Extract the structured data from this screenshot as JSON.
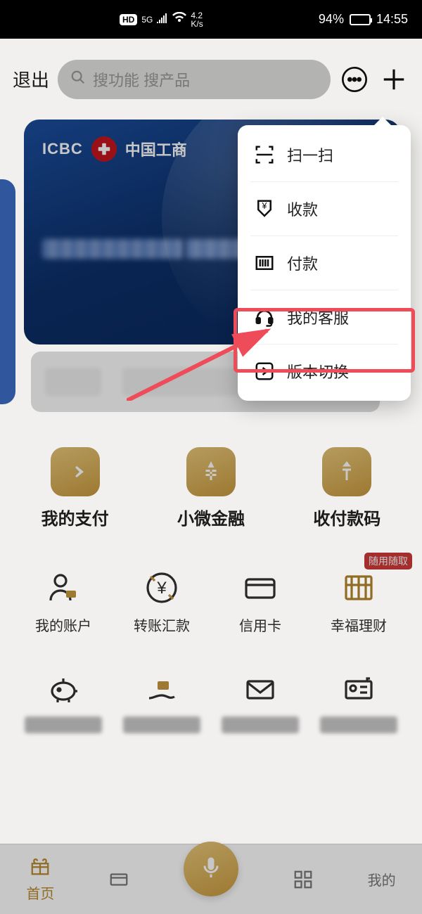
{
  "status": {
    "hd": "HD",
    "net": "5G",
    "speed_top": "4.2",
    "speed_bot": "K/s",
    "battery_pct": "94%",
    "time": "14:55"
  },
  "topbar": {
    "exit": "退出",
    "search_placeholder": "搜功能 搜产品"
  },
  "card": {
    "brand": "ICBC",
    "brand_cn": "中国工商"
  },
  "gold_row": [
    {
      "label": "我的支付"
    },
    {
      "label": "小微金融"
    },
    {
      "label": "收付款码"
    }
  ],
  "mini_grid": {
    "row1": [
      {
        "label": "我的账户"
      },
      {
        "label": "转账汇款"
      },
      {
        "label": "信用卡"
      },
      {
        "label": "幸福理财",
        "badge": "随用随取"
      }
    ]
  },
  "bottom_nav": {
    "home": "首页",
    "mine": "我的"
  },
  "dropdown": [
    {
      "label": "扫一扫"
    },
    {
      "label": "收款"
    },
    {
      "label": "付款"
    },
    {
      "label": "我的客服"
    },
    {
      "label": "版本切换"
    }
  ]
}
